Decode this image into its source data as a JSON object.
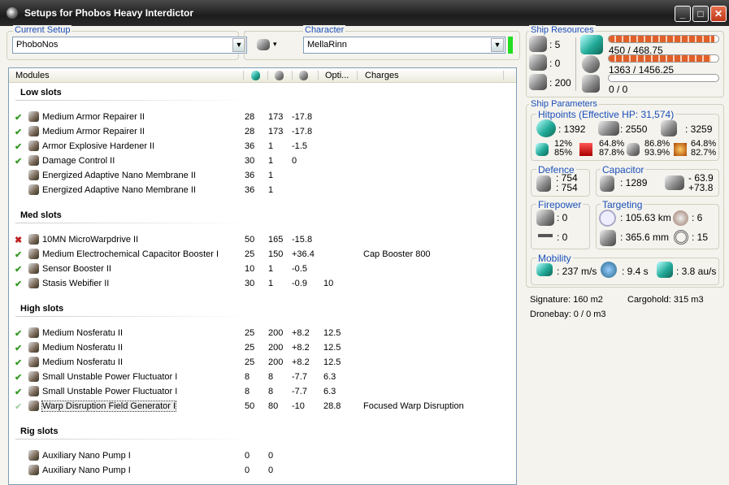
{
  "window": {
    "title": "Setups for Phobos Heavy Interdictor",
    "min": "_",
    "max": "□",
    "close": "✕"
  },
  "setup": {
    "label": "Current Setup",
    "value": "PhoboNos",
    "ship_menu": "▾"
  },
  "character": {
    "label": "Character",
    "value": "MellaRinn",
    "status_color": "#22dd22"
  },
  "list": {
    "headers": {
      "modules": "Modules",
      "optimal": "Opti...",
      "charges": "Charges"
    },
    "sections": [
      {
        "title": "Low slots",
        "rows": [
          {
            "state": "on",
            "name": "Medium Armor Repairer II",
            "c1": "28",
            "c2": "173",
            "c3": "-17.8",
            "opt": "",
            "charge": ""
          },
          {
            "state": "on",
            "name": "Medium Armor Repairer II",
            "c1": "28",
            "c2": "173",
            "c3": "-17.8",
            "opt": "",
            "charge": ""
          },
          {
            "state": "on",
            "name": "Armor Explosive Hardener II",
            "c1": "36",
            "c2": "1",
            "c3": "-1.5",
            "opt": "",
            "charge": ""
          },
          {
            "state": "on",
            "name": "Damage Control II",
            "c1": "30",
            "c2": "1",
            "c3": "0",
            "opt": "",
            "charge": ""
          },
          {
            "state": "passive",
            "name": "Energized Adaptive Nano Membrane II",
            "c1": "36",
            "c2": "1",
            "c3": "",
            "opt": "",
            "charge": ""
          },
          {
            "state": "passive",
            "name": "Energized Adaptive Nano Membrane II",
            "c1": "36",
            "c2": "1",
            "c3": "",
            "opt": "",
            "charge": ""
          }
        ]
      },
      {
        "title": "Med slots",
        "rows": [
          {
            "state": "off",
            "name": "10MN MicroWarpdrive II",
            "c1": "50",
            "c2": "165",
            "c3": "-15.8",
            "opt": "",
            "charge": ""
          },
          {
            "state": "on",
            "name": "Medium Electrochemical Capacitor Booster I",
            "c1": "25",
            "c2": "150",
            "c3": "+36.4",
            "opt": "",
            "charge": "Cap Booster 800"
          },
          {
            "state": "on",
            "name": "Sensor Booster II",
            "c1": "10",
            "c2": "1",
            "c3": "-0.5",
            "opt": "",
            "charge": ""
          },
          {
            "state": "on",
            "name": "Stasis Webifier II",
            "c1": "30",
            "c2": "1",
            "c3": "-0.9",
            "opt": "10",
            "charge": ""
          }
        ]
      },
      {
        "title": "High slots",
        "rows": [
          {
            "state": "on",
            "name": "Medium Nosferatu II",
            "c1": "25",
            "c2": "200",
            "c3": "+8.2",
            "opt": "12.5",
            "charge": ""
          },
          {
            "state": "on",
            "name": "Medium Nosferatu II",
            "c1": "25",
            "c2": "200",
            "c3": "+8.2",
            "opt": "12.5",
            "charge": ""
          },
          {
            "state": "on",
            "name": "Medium Nosferatu II",
            "c1": "25",
            "c2": "200",
            "c3": "+8.2",
            "opt": "12.5",
            "charge": ""
          },
          {
            "state": "on",
            "name": "Small Unstable Power Fluctuator I",
            "c1": "8",
            "c2": "8",
            "c3": "-7.7",
            "opt": "6.3",
            "charge": ""
          },
          {
            "state": "on",
            "name": "Small Unstable Power Fluctuator I",
            "c1": "8",
            "c2": "8",
            "c3": "-7.7",
            "opt": "6.3",
            "charge": ""
          },
          {
            "state": "faint",
            "name": "Warp Disruption Field Generator I",
            "c1": "50",
            "c2": "80",
            "c3": "-10",
            "opt": "28.8",
            "charge": "Focused Warp Disruption",
            "selected": true
          }
        ]
      },
      {
        "title": "Rig slots",
        "rows": [
          {
            "state": "passive",
            "name": "Auxiliary Nano Pump I",
            "c1": "0",
            "c2": "0",
            "c3": "",
            "opt": "",
            "charge": ""
          },
          {
            "state": "passive",
            "name": "Auxiliary Nano Pump I",
            "c1": "0",
            "c2": "0",
            "c3": "",
            "opt": "",
            "charge": ""
          }
        ]
      }
    ]
  },
  "resources": {
    "title": "Ship Resources",
    "turrets": ": 5",
    "launchers": ": 0",
    "calibration": ": 200",
    "cpu": {
      "text": "450 / 468.75",
      "fraction": 0.96
    },
    "power": {
      "text": "1363 / 1456.25",
      "fraction": 0.936
    },
    "drone": {
      "text": "0 / 0",
      "fraction": 0
    }
  },
  "params": {
    "title": "Ship Parameters",
    "hp_title": "Hitpoints (Effective HP: 31,574)",
    "shield": ": 1392",
    "armor": ": 2550",
    "structure": ": 3259",
    "resists": [
      [
        "12%",
        "85%"
      ],
      [
        "64.8%",
        "87.8%"
      ],
      [
        "86.8%",
        "93.9%"
      ],
      [
        "64.8%",
        "82.7%"
      ]
    ],
    "defence": {
      "title": "Defence",
      "a": ": 754",
      "b": ": 754"
    },
    "capacitor": {
      "title": "Capacitor",
      "cap": ": 1289",
      "use": "- 63.9",
      "recharge": "+73.8"
    },
    "firepower": {
      "title": "Firepower",
      "turret": ": 0",
      "missile": ": 0"
    },
    "targeting": {
      "title": "Targeting",
      "range": ": 105.63 km",
      "targets": ": 6",
      "scanres": ": 365.6 mm",
      "sensor": ": 15"
    },
    "mobility": {
      "title": "Mobility",
      "speed": ": 237 m/s",
      "align": ": 9.4 s",
      "warp": ": 3.8 au/s"
    },
    "signature": "Signature: 160 m2",
    "cargo": "Cargohold: 315 m3",
    "dronebay": "Dronebay: 0 / 0 m3"
  }
}
